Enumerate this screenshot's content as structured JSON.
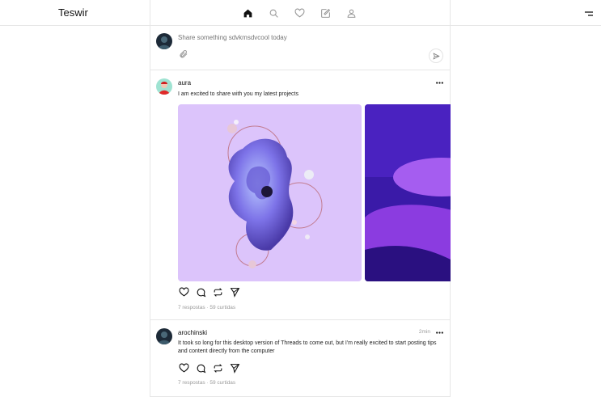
{
  "app": {
    "brand": "Teswir"
  },
  "nav": {
    "items": [
      {
        "icon": "home-icon",
        "active": true
      },
      {
        "icon": "search-icon",
        "active": false
      },
      {
        "icon": "heart-icon",
        "active": false
      },
      {
        "icon": "edit-icon",
        "active": false
      },
      {
        "icon": "user-icon",
        "active": false
      }
    ],
    "menu_icon": "menu-icon"
  },
  "composer": {
    "placeholder": "Share something sdvkmsdvcool today",
    "attach_icon": "paperclip-icon",
    "send_icon": "send-icon"
  },
  "posts": [
    {
      "username": "aura",
      "text": "I am excited to share with you my latest projects",
      "time": "",
      "images": [
        "abstract-3d-purple-sculpture",
        "purple-abstract-shapes"
      ],
      "stats": "7 respostas · 59 curtidas"
    },
    {
      "username": "arochinski",
      "text": "It took so long for this desktop version of Threads to come out, but I'm really excited to start posting tips and content directly from the computer",
      "time": "2min",
      "stats": "7 respostas · 59 curtidas"
    }
  ],
  "colors": {
    "border": "#e6e6e6",
    "muted": "#9a9a9a",
    "text": "#111111",
    "image1_bg": "#dcc4fb",
    "image2_bg": "#3a1aa8"
  }
}
